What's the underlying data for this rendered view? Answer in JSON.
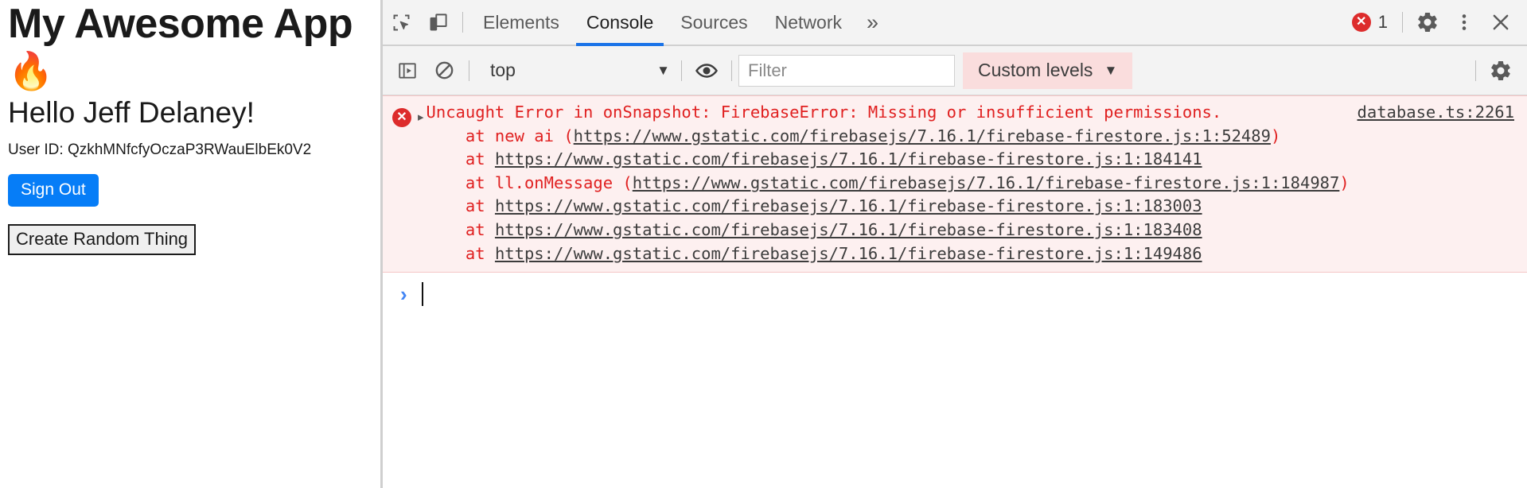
{
  "page": {
    "title_text": "My Awesome App",
    "title_emoji": "🔥",
    "greeting": "Hello Jeff Delaney!",
    "user_id_line": "User ID: QzkhMNfcfyOczaP3RWauElbEk0V2",
    "sign_out_label": "Sign Out",
    "create_thing_label": "Create Random Thing",
    "accent_color": "#067df7"
  },
  "devtools": {
    "tabs": [
      {
        "label": "Elements",
        "active": false
      },
      {
        "label": "Console",
        "active": true
      },
      {
        "label": "Sources",
        "active": false
      },
      {
        "label": "Network",
        "active": false
      }
    ],
    "more_tabs_glyph": "»",
    "error_count": "1",
    "active_tab_underline_color": "#1a73e8",
    "inspect_icon_name": "inspect-element-icon",
    "device_toolbar_icon_name": "device-toolbar-icon",
    "settings_icon_name": "gear-icon",
    "more_options_icon_name": "kebab-menu-icon",
    "close_icon_name": "close-icon",
    "console_toolbar": {
      "sidebar_toggle_icon_name": "console-sidebar-toggle-icon",
      "clear_icon_name": "clear-console-icon",
      "context_value": "top",
      "context_caret": "▼",
      "live_expression_icon_name": "eye-icon",
      "filter_placeholder": "Filter",
      "filter_value": "",
      "levels_label": "Custom levels",
      "levels_caret": "▼",
      "levels_highlight_color": "#fadddd",
      "settings_icon_name": "console-settings-gear-icon"
    },
    "message": {
      "severity": "error",
      "source_link": "database.ts:2261",
      "background": "#fdf0f0",
      "text_color": "#e02020",
      "disclosure_glyph": "▸",
      "header": "Uncaught Error in onSnapshot: FirebaseError: Missing or insufficient permissions.",
      "stack": [
        {
          "prefix": "    at new ai (",
          "link": "https://www.gstatic.com/firebasejs/7.16.1/firebase-firestore.js:1:52489",
          "suffix": ")"
        },
        {
          "prefix": "    at ",
          "link": "https://www.gstatic.com/firebasejs/7.16.1/firebase-firestore.js:1:184141",
          "suffix": ""
        },
        {
          "prefix": "    at ll.onMessage (",
          "link": "https://www.gstatic.com/firebasejs/7.16.1/firebase-firestore.js:1:184987",
          "suffix": ")"
        },
        {
          "prefix": "    at ",
          "link": "https://www.gstatic.com/firebasejs/7.16.1/firebase-firestore.js:1:183003",
          "suffix": ""
        },
        {
          "prefix": "    at ",
          "link": "https://www.gstatic.com/firebasejs/7.16.1/firebase-firestore.js:1:183408",
          "suffix": ""
        },
        {
          "prefix": "    at ",
          "link": "https://www.gstatic.com/firebasejs/7.16.1/firebase-firestore.js:1:149486",
          "suffix": ""
        }
      ]
    },
    "prompt": {
      "caret": "›",
      "value": ""
    }
  }
}
